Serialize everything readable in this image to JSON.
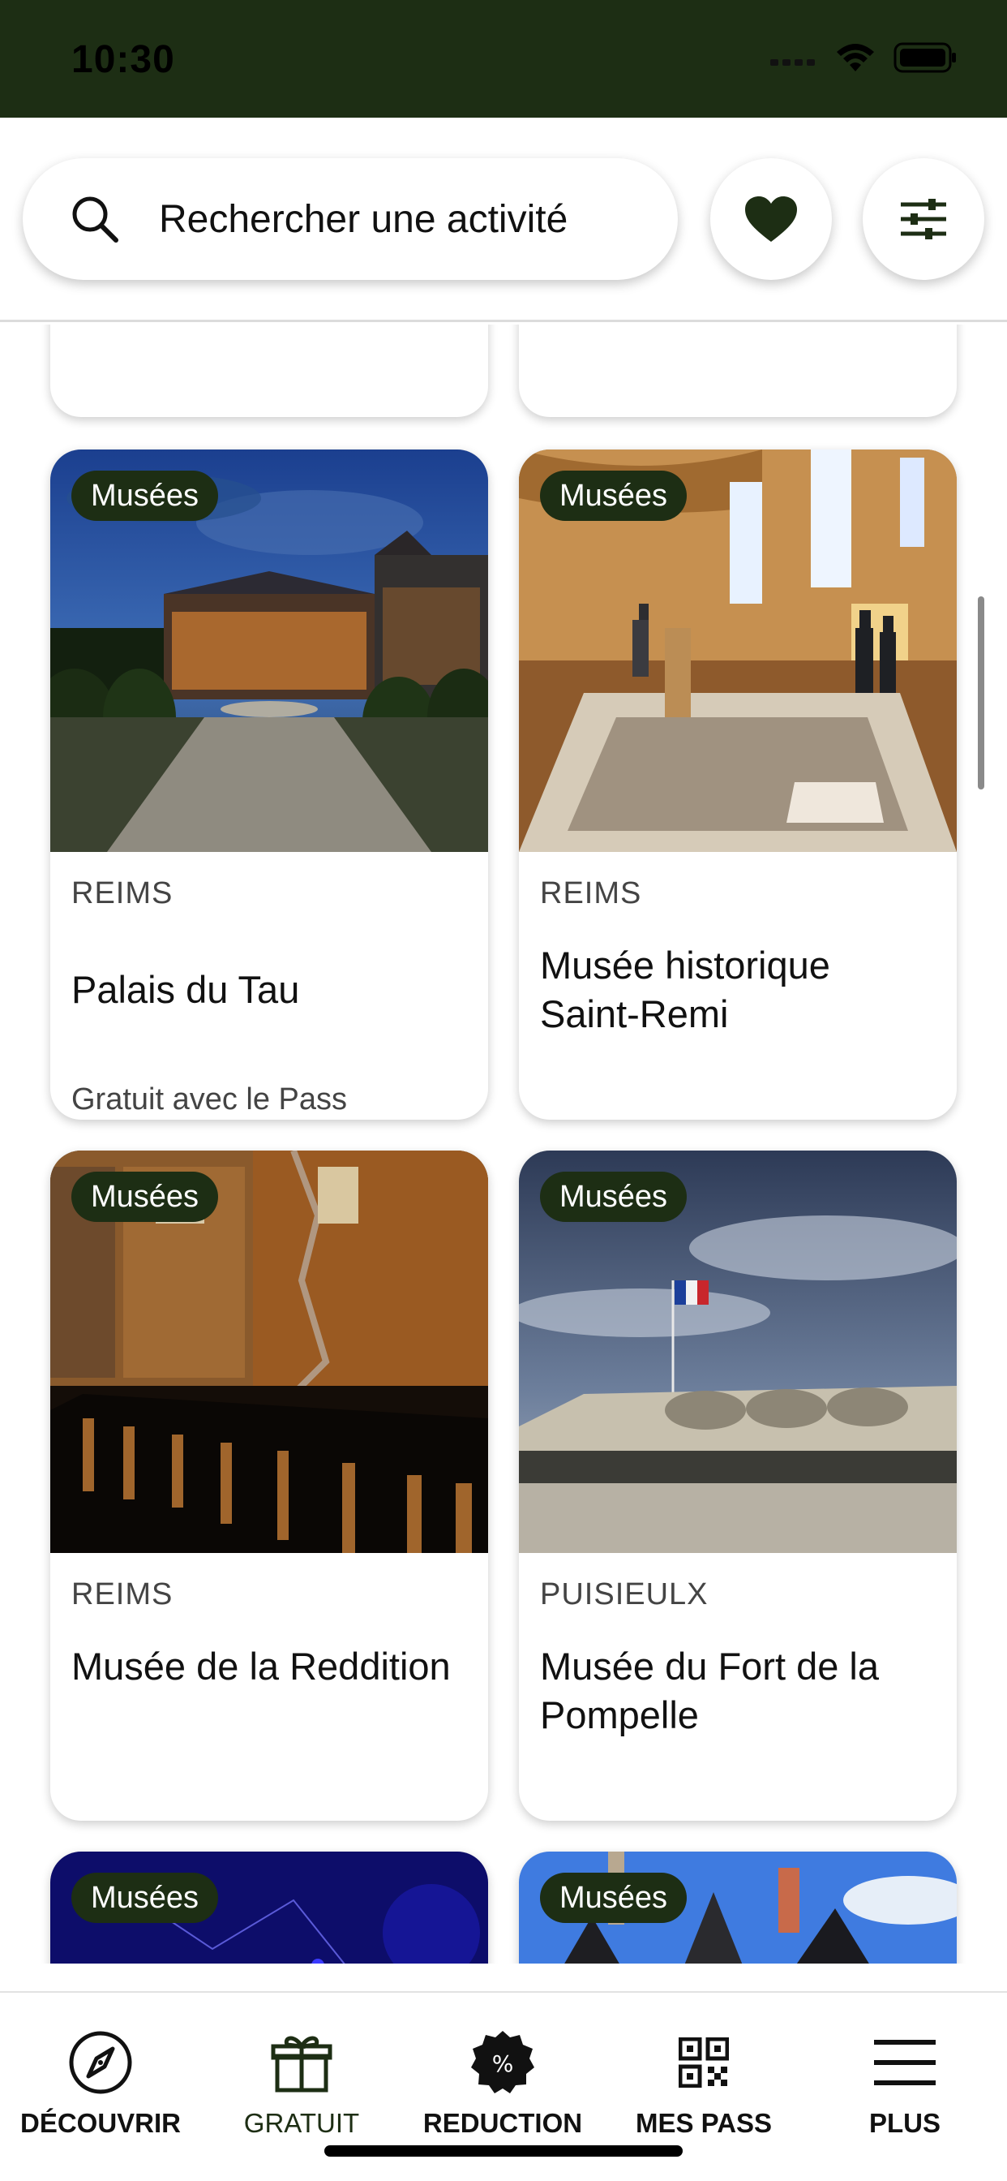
{
  "status_bar": {
    "time": "10:30"
  },
  "search": {
    "placeholder": "Rechercher une activité"
  },
  "cards": [
    {
      "badge": "Musées",
      "city": "REIMS",
      "title": "Palais du Tau",
      "subtitle": "Gratuit avec le Pass"
    },
    {
      "badge": "Musées",
      "city": "REIMS",
      "title": "Musée historique Saint-Remi",
      "subtitle": ""
    },
    {
      "badge": "Musées",
      "city": "REIMS",
      "title": "Musée de la Reddition",
      "subtitle": ""
    },
    {
      "badge": "Musées",
      "city": "PUISIEULX",
      "title": "Musée du Fort de la Pompelle",
      "subtitle": ""
    },
    {
      "badge": "Musées"
    },
    {
      "badge": "Musées"
    }
  ],
  "tabs": [
    {
      "label": "DÉCOUVRIR",
      "icon": "compass-icon"
    },
    {
      "label": "GRATUIT",
      "icon": "gift-icon",
      "active": true
    },
    {
      "label": "REDUCTION",
      "icon": "percent-badge-icon"
    },
    {
      "label": "MES PASS",
      "icon": "qr-code-icon"
    },
    {
      "label": "PLUS",
      "icon": "menu-icon"
    }
  ],
  "colors": {
    "brand_dark_green": "#1d2e14",
    "white": "#ffffff"
  }
}
